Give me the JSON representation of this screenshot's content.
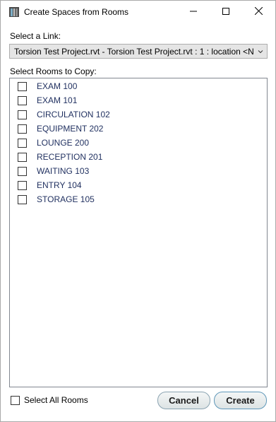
{
  "window": {
    "title": "Create Spaces from Rooms",
    "icons": [
      "app-icon",
      "minimize-icon",
      "maximize-icon",
      "close-icon"
    ]
  },
  "link": {
    "label": "Select a Link:",
    "selected": "Torsion Test Project.rvt - Torsion Test Project.rvt : 1 : location <Not Sha"
  },
  "rooms": {
    "label": "Select Rooms to Copy:",
    "items": [
      {
        "name": "EXAM 100",
        "checked": false
      },
      {
        "name": "EXAM 101",
        "checked": false
      },
      {
        "name": "CIRCULATION 102",
        "checked": false
      },
      {
        "name": "EQUIPMENT 202",
        "checked": false
      },
      {
        "name": "LOUNGE 200",
        "checked": false
      },
      {
        "name": "RECEPTION 201",
        "checked": false
      },
      {
        "name": "WAITING 103",
        "checked": false
      },
      {
        "name": "ENTRY 104",
        "checked": false
      },
      {
        "name": "STORAGE 105",
        "checked": false
      }
    ]
  },
  "footer": {
    "select_all_label": "Select All Rooms",
    "cancel_label": "Cancel",
    "create_label": "Create"
  },
  "colors": {
    "room_text": "#1f2f5f",
    "button_border": "#8aa3b1"
  }
}
